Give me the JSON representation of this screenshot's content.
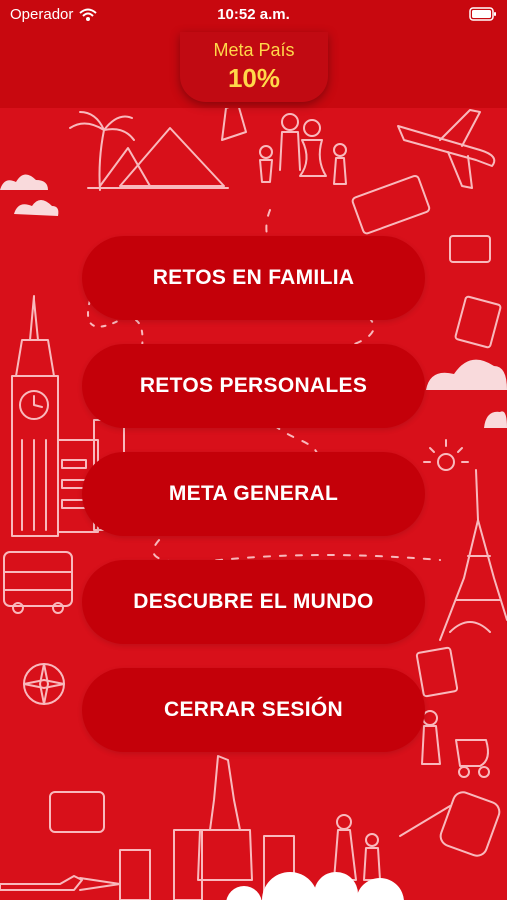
{
  "status_bar": {
    "carrier": "Operador",
    "time": "10:52 a.m.",
    "icons": [
      "wifi-icon",
      "battery-icon"
    ]
  },
  "header": {
    "meta_label": "Meta País",
    "meta_value": "10%"
  },
  "menu": {
    "items": [
      {
        "label": "RETOS EN FAMILIA"
      },
      {
        "label": "RETOS PERSONALES"
      },
      {
        "label": "META GENERAL"
      },
      {
        "label": "DESCUBRE EL MUNDO"
      },
      {
        "label": "CERRAR SESIÓN"
      }
    ]
  },
  "colors": {
    "background": "#d8101a",
    "header": "#c8080f",
    "button": "#c40009",
    "accent": "#ffd84a",
    "text": "#ffffff"
  }
}
